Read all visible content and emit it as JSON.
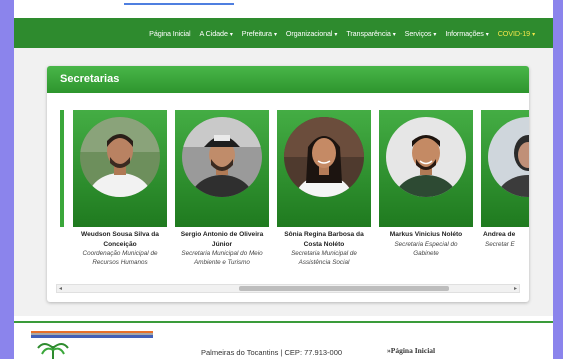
{
  "nav": {
    "items": [
      {
        "label": "Página Inicial",
        "caret": ""
      },
      {
        "label": "A Cidade",
        "caret": "▾"
      },
      {
        "label": "Prefeitura",
        "caret": "▾"
      },
      {
        "label": "Organizacional",
        "caret": "▾"
      },
      {
        "label": "Transparência",
        "caret": "▾"
      },
      {
        "label": "Serviços",
        "caret": "▾"
      },
      {
        "label": "Informações",
        "caret": "▾"
      },
      {
        "label": "COVID-19",
        "caret": "▾"
      }
    ]
  },
  "section": {
    "title": "Secretarias"
  },
  "people": [
    {
      "name": "Weudson Sousa Silva da Conceição",
      "role": "Coordenação Municipal de Recursos Humanos",
      "photo_icon": "person-photo-icon"
    },
    {
      "name": "Sergio Antonio de Oliveira Júnior",
      "role": "Secretaria Municipal do Meio Ambiente e Turismo",
      "photo_icon": "person-photo-icon"
    },
    {
      "name": "Sônia Regina Barbosa da Costa Noléto",
      "role": "Secretaria Municipal de Assistência Social",
      "photo_icon": "person-photo-icon"
    },
    {
      "name": "Markus Vinicius Noléto",
      "role": "Secretaria Especial do Gabinete",
      "photo_icon": "person-photo-icon"
    },
    {
      "name": "Andrea de",
      "role": "Secretar E",
      "photo_icon": "person-photo-icon"
    }
  ],
  "footer": {
    "address": "Palmeiras do Tocantins | CEP: 77.913-000",
    "home_link": "»Página Inicial"
  },
  "colors": {
    "nav_green": "#2e8b2e",
    "covid_yellow": "#f1e64a",
    "side_purple": "#8b84ec"
  }
}
